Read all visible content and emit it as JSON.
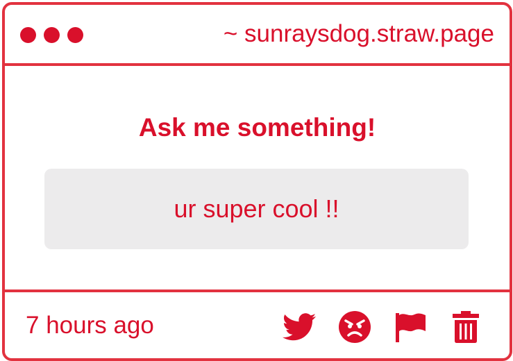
{
  "window": {
    "site_url": "~ sunraysdog.straw.page",
    "dots": [
      "window-dot-1",
      "window-dot-2",
      "window-dot-3"
    ]
  },
  "question": {
    "prompt": "Ask me something!",
    "answer": "ur super cool !!"
  },
  "footer": {
    "timestamp": "7 hours ago",
    "actions": [
      "twitter-icon",
      "angry-face-icon",
      "flag-icon",
      "trash-icon"
    ]
  },
  "colors": {
    "accent": "#d9102b",
    "border": "#e2323f",
    "answer_bg": "#ecebec"
  }
}
